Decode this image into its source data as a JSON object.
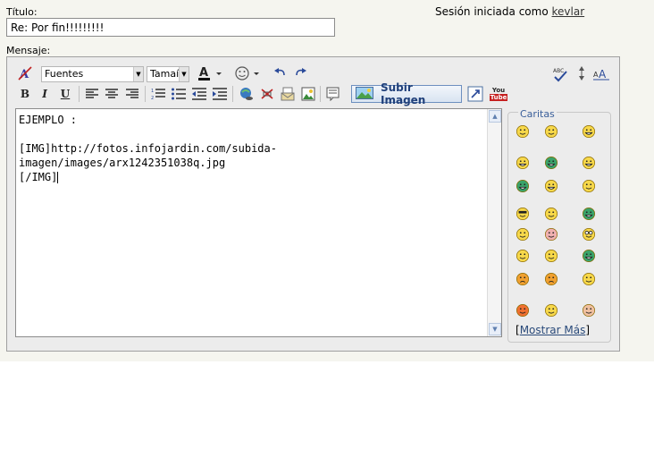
{
  "header": {
    "title_label": "Título:",
    "title_value": "Re: Por fin!!!!!!!!!",
    "session_text": "Sesión iniciada como",
    "username": "kevlar",
    "message_label": "Mensaje:"
  },
  "toolbar": {
    "font_combo": "Fuentes",
    "size_combo": "Tamaí",
    "upload_button": "Subir Imagen",
    "icons": {
      "remove_format": "remove-format-icon",
      "font_color": "font-color-icon",
      "emoticon": "emoticon-icon",
      "undo": "undo-icon",
      "redo": "redo-icon",
      "spellcheck": "spellcheck-icon",
      "resize": "resize-icon",
      "font_size": "font-size-icon",
      "bold": "bold-icon",
      "italic": "italic-icon",
      "underline": "underline-icon",
      "align_left": "align-left-icon",
      "align_center": "align-center-icon",
      "align_right": "align-right-icon",
      "ordered_list": "ordered-list-icon",
      "unordered_list": "unordered-list-icon",
      "outdent": "outdent-icon",
      "indent": "indent-icon",
      "link": "link-icon",
      "unlink": "unlink-icon",
      "email": "email-icon",
      "image": "image-icon",
      "quote": "quote-icon",
      "toggle_source": "toggle-source-icon",
      "youtube": "youtube-icon"
    },
    "labels": {
      "bold": "B",
      "italic": "I",
      "underline": "U",
      "youtube_top": "You",
      "youtube_bottom": "Tube"
    }
  },
  "editor": {
    "lines": [
      "EJEMPLO :",
      "",
      "[IMG]http://fotos.infojardin.com/subida-imagen/images/arx1242351038q.jpg",
      "[/IMG]"
    ]
  },
  "smileys": {
    "legend": "Caritas",
    "more_link": "Mostrar Más",
    "colors": {
      "face": "#f7d84a",
      "outline": "#8a6a00",
      "green": "#3aa36a",
      "red": "#c63a2a"
    }
  }
}
